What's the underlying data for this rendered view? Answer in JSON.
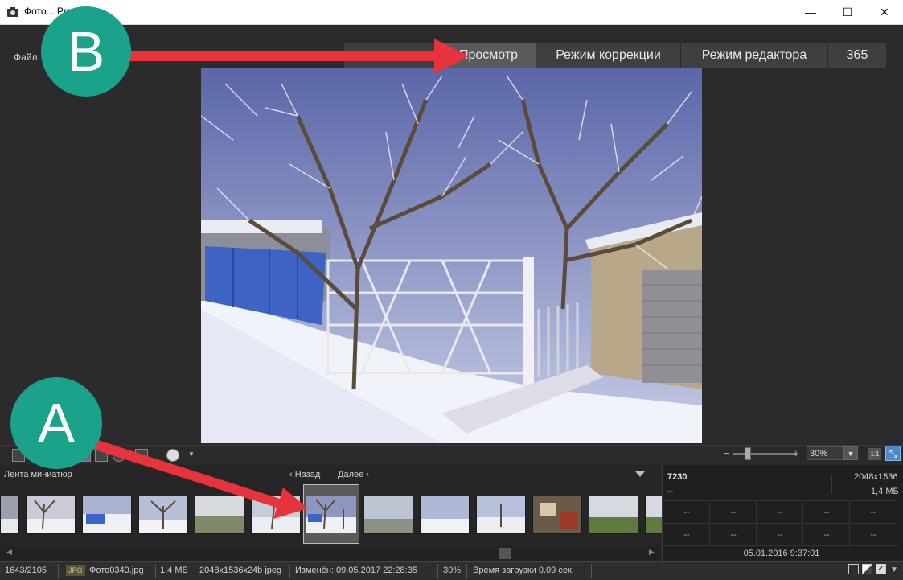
{
  "window": {
    "title": "Фото... Pro 7",
    "minimize": "—",
    "maximize": "☐",
    "close": "✕"
  },
  "menu": {
    "file": "Файл"
  },
  "modes": [
    {
      "label": "Просмотр",
      "active": true
    },
    {
      "label": "Режим коррекции",
      "active": false
    },
    {
      "label": "Режим редактора",
      "active": false
    },
    {
      "label": "365",
      "active": false
    }
  ],
  "toolbar": {
    "zoom_minus": "−",
    "zoom_plus": "+",
    "zoom_value": "30%",
    "zoom_level_percent": 30,
    "one_to_one": "1:1"
  },
  "filmstrip": {
    "title": "Лента миниатюр",
    "prev": "Назад",
    "next": "Далее",
    "selected_index": 6
  },
  "info": {
    "id": "7230",
    "resolution": "2048x1536",
    "dash": "--",
    "size": "1,4 МБ",
    "grid_values": [
      "--",
      "--",
      "--",
      "--",
      "--",
      "--",
      "--",
      "--",
      "--",
      "--"
    ],
    "datetime": "05.01.2016 9:37:01"
  },
  "status": {
    "counter": "1643/2105",
    "format": "JPG",
    "filename": "Фото0340.jpg",
    "filesize": "1,4 МБ",
    "details": "2048x1536x24b jpeg",
    "modified": "Изменён: 09.05.2017 22:28:35",
    "zoom": "30%",
    "load_time": "Время загрузки 0.09 сек."
  },
  "callouts": {
    "a": "A",
    "b": "B"
  },
  "colors": {
    "accent_teal": "#1aa38a",
    "arrow_red": "#e8333c",
    "active_tab": "#5a5a5a"
  }
}
